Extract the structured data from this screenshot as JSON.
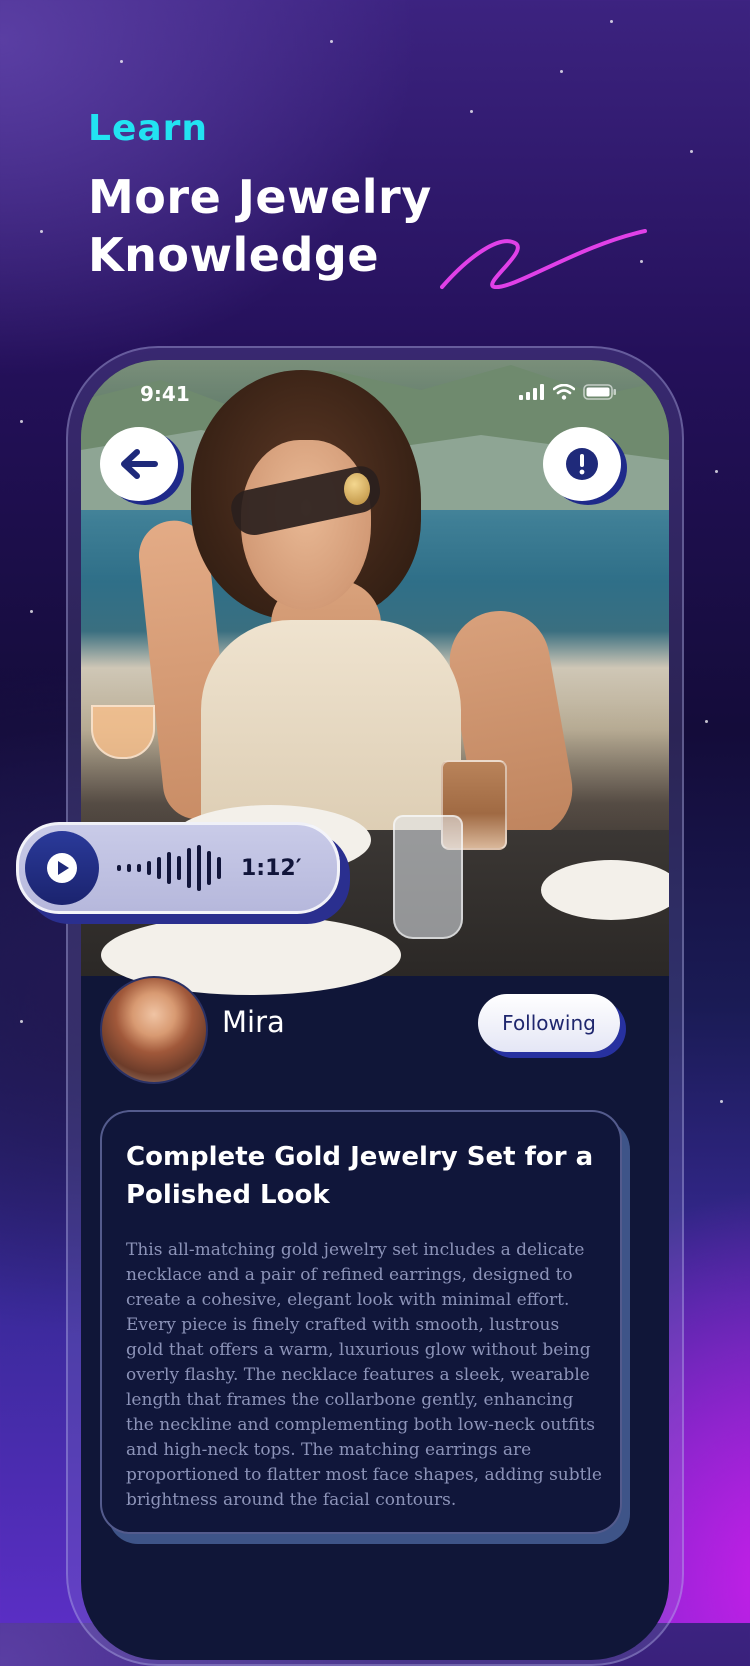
{
  "headline": {
    "eyebrow": "Learn",
    "title": "More Jewelry Knowledge"
  },
  "status_bar": {
    "time": "9:41"
  },
  "post": {
    "audio": {
      "duration": "1:12′"
    },
    "author": {
      "name": "Mira",
      "follow_label": "Following"
    },
    "title": "Complete Gold Jewelry Set for a Polished Look",
    "description": "This all-matching gold jewelry set includes a delicate necklace and a pair of refined earrings, designed to create a cohesive, elegant look with minimal effort. Every piece is finely crafted with smooth, lustrous gold that offers a warm, luxurious glow without being overly flashy. The necklace features a sleek, wearable length that frames the collarbone gently, enhancing the neckline and complementing both low-neck outfits and high-neck tops. The matching earrings are proportioned to flatter most face shapes, adding subtle brightness around the facial contours."
  },
  "icons": {
    "back": "arrow-left-icon",
    "alert": "exclamation-icon",
    "play": "play-icon",
    "signal": "cellular-signal-icon",
    "wifi": "wifi-icon",
    "battery": "battery-icon"
  },
  "colors": {
    "eyebrow": "#22e3f2",
    "accent_swoosh": "#e040e8",
    "button_shadow": "#2731a0",
    "card_bg": "#10163a"
  }
}
